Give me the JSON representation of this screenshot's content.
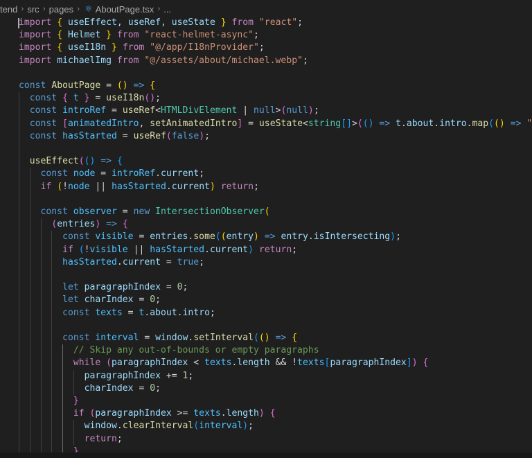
{
  "breadcrumb": {
    "items": [
      "tend",
      "src",
      "pages",
      "AboutPage.tsx",
      "..."
    ],
    "separator": "›",
    "file_icon": "react-tsx-icon"
  },
  "editor": {
    "language": "tsx",
    "theme": "dark-modern",
    "lines": [
      [
        [
          "import",
          "kw-c"
        ],
        [
          " ",
          "pun"
        ],
        [
          "{",
          "b1"
        ],
        [
          " useEffect, useRef, useState ",
          "var"
        ],
        [
          "}",
          "b1"
        ],
        [
          " from ",
          "kw-c"
        ],
        [
          "\"react\"",
          "str"
        ],
        [
          ";",
          "pun"
        ]
      ],
      [
        [
          "import",
          "kw-c"
        ],
        [
          " ",
          "pun"
        ],
        [
          "{",
          "b1"
        ],
        [
          " Helmet ",
          "var"
        ],
        [
          "}",
          "b1"
        ],
        [
          " from ",
          "kw-c"
        ],
        [
          "\"react-helmet-async\"",
          "str"
        ],
        [
          ";",
          "pun"
        ]
      ],
      [
        [
          "import",
          "kw-c"
        ],
        [
          " ",
          "pun"
        ],
        [
          "{",
          "b1"
        ],
        [
          " useI18n ",
          "var"
        ],
        [
          "}",
          "b1"
        ],
        [
          " from ",
          "kw-c"
        ],
        [
          "\"@/app/I18nProvider\"",
          "str"
        ],
        [
          ";",
          "pun"
        ]
      ],
      [
        [
          "import",
          "kw-c"
        ],
        [
          " michaelImg ",
          "var"
        ],
        [
          "from ",
          "kw-c"
        ],
        [
          "\"@/assets/about/michael.webp\"",
          "str"
        ],
        [
          ";",
          "pun"
        ]
      ],
      [],
      [
        [
          "const ",
          "kw"
        ],
        [
          "AboutPage",
          "fn"
        ],
        [
          " = ",
          "pun"
        ],
        [
          "()",
          "b1"
        ],
        [
          " => ",
          "kw"
        ],
        [
          "{",
          "b1"
        ]
      ],
      [
        [
          "  const ",
          "kw"
        ],
        [
          "{",
          "b2"
        ],
        [
          " t ",
          "cst"
        ],
        [
          "}",
          "b2"
        ],
        [
          " = ",
          "pun"
        ],
        [
          "useI18n",
          "fn"
        ],
        [
          "()",
          "b2"
        ],
        [
          ";",
          "pun"
        ]
      ],
      [
        [
          "  const ",
          "kw"
        ],
        [
          "introRef",
          "cst"
        ],
        [
          " = ",
          "pun"
        ],
        [
          "useRef",
          "fn"
        ],
        [
          "<",
          "pun"
        ],
        [
          "HTMLDivElement",
          "typ"
        ],
        [
          " | ",
          "pun"
        ],
        [
          "null",
          "kw"
        ],
        [
          ">",
          "pun"
        ],
        [
          "(",
          "b2"
        ],
        [
          "null",
          "kw"
        ],
        [
          ")",
          "b2"
        ],
        [
          ";",
          "pun"
        ]
      ],
      [
        [
          "  const ",
          "kw"
        ],
        [
          "[",
          "b2"
        ],
        [
          "animatedIntro",
          "cst"
        ],
        [
          ", ",
          "pun"
        ],
        [
          "setAnimatedIntro",
          "fn"
        ],
        [
          "]",
          "b2"
        ],
        [
          " = ",
          "pun"
        ],
        [
          "useState",
          "fn"
        ],
        [
          "<",
          "pun"
        ],
        [
          "string",
          "typ"
        ],
        [
          "[]",
          "b3"
        ],
        [
          ">",
          "pun"
        ],
        [
          "(",
          "b2"
        ],
        [
          "()",
          "b3"
        ],
        [
          " => ",
          "kw"
        ],
        [
          "t",
          "var"
        ],
        [
          ".",
          "pun"
        ],
        [
          "about",
          "var"
        ],
        [
          ".",
          "pun"
        ],
        [
          "intro",
          "var"
        ],
        [
          ".",
          "pun"
        ],
        [
          "map",
          "fn"
        ],
        [
          "(",
          "b3"
        ],
        [
          "()",
          "b1"
        ],
        [
          " => ",
          "kw"
        ],
        [
          "\"\"",
          "str"
        ],
        [
          ")",
          "b3"
        ],
        [
          ")",
          "b2"
        ],
        [
          ";",
          "pun"
        ]
      ],
      [
        [
          "  const ",
          "kw"
        ],
        [
          "hasStarted",
          "cst"
        ],
        [
          " = ",
          "pun"
        ],
        [
          "useRef",
          "fn"
        ],
        [
          "(",
          "b2"
        ],
        [
          "false",
          "kw"
        ],
        [
          ")",
          "b2"
        ],
        [
          ";",
          "pun"
        ]
      ],
      [],
      [
        [
          "  ",
          "pun"
        ],
        [
          "useEffect",
          "fn"
        ],
        [
          "(",
          "b2"
        ],
        [
          "()",
          "b3"
        ],
        [
          " => ",
          "kw"
        ],
        [
          "{",
          "b3"
        ]
      ],
      [
        [
          "    const ",
          "kw"
        ],
        [
          "node",
          "cst"
        ],
        [
          " = ",
          "pun"
        ],
        [
          "introRef",
          "cst"
        ],
        [
          ".",
          "pun"
        ],
        [
          "current",
          "var"
        ],
        [
          ";",
          "pun"
        ]
      ],
      [
        [
          "    if ",
          "kw-c"
        ],
        [
          "(",
          "b1"
        ],
        [
          "!",
          "pun"
        ],
        [
          "node",
          "cst"
        ],
        [
          " || ",
          "pun"
        ],
        [
          "hasStarted",
          "cst"
        ],
        [
          ".",
          "pun"
        ],
        [
          "current",
          "var"
        ],
        [
          ")",
          "b1"
        ],
        [
          " return",
          "kw-c"
        ],
        [
          ";",
          "pun"
        ]
      ],
      [],
      [
        [
          "    const ",
          "kw"
        ],
        [
          "observer",
          "cst"
        ],
        [
          " = ",
          "pun"
        ],
        [
          "new ",
          "kw"
        ],
        [
          "IntersectionObserver",
          "typ"
        ],
        [
          "(",
          "b1"
        ]
      ],
      [
        [
          "      ",
          "pun"
        ],
        [
          "(",
          "b2"
        ],
        [
          "entries",
          "var"
        ],
        [
          ")",
          "b2"
        ],
        [
          " => ",
          "kw"
        ],
        [
          "{",
          "b2"
        ]
      ],
      [
        [
          "        const ",
          "kw"
        ],
        [
          "visible",
          "cst"
        ],
        [
          " = ",
          "pun"
        ],
        [
          "entries",
          "var"
        ],
        [
          ".",
          "pun"
        ],
        [
          "some",
          "fn"
        ],
        [
          "(",
          "b3"
        ],
        [
          "(",
          "b1"
        ],
        [
          "entry",
          "var"
        ],
        [
          ")",
          "b1"
        ],
        [
          " => ",
          "kw"
        ],
        [
          "entry",
          "var"
        ],
        [
          ".",
          "pun"
        ],
        [
          "isIntersecting",
          "var"
        ],
        [
          ")",
          "b3"
        ],
        [
          ";",
          "pun"
        ]
      ],
      [
        [
          "        if ",
          "kw-c"
        ],
        [
          "(",
          "b3"
        ],
        [
          "!",
          "pun"
        ],
        [
          "visible",
          "cst"
        ],
        [
          " || ",
          "pun"
        ],
        [
          "hasStarted",
          "cst"
        ],
        [
          ".",
          "pun"
        ],
        [
          "current",
          "var"
        ],
        [
          ")",
          "b3"
        ],
        [
          " return",
          "kw-c"
        ],
        [
          ";",
          "pun"
        ]
      ],
      [
        [
          "        ",
          "pun"
        ],
        [
          "hasStarted",
          "cst"
        ],
        [
          ".",
          "pun"
        ],
        [
          "current",
          "var"
        ],
        [
          " = ",
          "pun"
        ],
        [
          "true",
          "kw"
        ],
        [
          ";",
          "pun"
        ]
      ],
      [],
      [
        [
          "        let ",
          "kw"
        ],
        [
          "paragraphIndex",
          "var"
        ],
        [
          " = ",
          "pun"
        ],
        [
          "0",
          "num"
        ],
        [
          ";",
          "pun"
        ]
      ],
      [
        [
          "        let ",
          "kw"
        ],
        [
          "charIndex",
          "var"
        ],
        [
          " = ",
          "pun"
        ],
        [
          "0",
          "num"
        ],
        [
          ";",
          "pun"
        ]
      ],
      [
        [
          "        const ",
          "kw"
        ],
        [
          "texts",
          "cst"
        ],
        [
          " = ",
          "pun"
        ],
        [
          "t",
          "cst"
        ],
        [
          ".",
          "pun"
        ],
        [
          "about",
          "var"
        ],
        [
          ".",
          "pun"
        ],
        [
          "intro",
          "var"
        ],
        [
          ";",
          "pun"
        ]
      ],
      [],
      [
        [
          "        const ",
          "kw"
        ],
        [
          "interval",
          "cst"
        ],
        [
          " = ",
          "pun"
        ],
        [
          "window",
          "var"
        ],
        [
          ".",
          "pun"
        ],
        [
          "setInterval",
          "fn"
        ],
        [
          "(",
          "b3"
        ],
        [
          "()",
          "b1"
        ],
        [
          " => ",
          "kw"
        ],
        [
          "{",
          "b1"
        ]
      ],
      [
        [
          "          // Skip any out-of-bounds or empty paragraphs",
          "cmt"
        ]
      ],
      [
        [
          "          while ",
          "kw-c"
        ],
        [
          "(",
          "b2"
        ],
        [
          "paragraphIndex",
          "var"
        ],
        [
          " < ",
          "pun"
        ],
        [
          "texts",
          "cst"
        ],
        [
          ".",
          "pun"
        ],
        [
          "length",
          "var"
        ],
        [
          " && ",
          "pun"
        ],
        [
          "!",
          "pun"
        ],
        [
          "texts",
          "cst"
        ],
        [
          "[",
          "b3"
        ],
        [
          "paragraphIndex",
          "var"
        ],
        [
          "]",
          "b3"
        ],
        [
          ")",
          "b2"
        ],
        [
          " ",
          "pun"
        ],
        [
          "{",
          "b2"
        ]
      ],
      [
        [
          "            ",
          "pun"
        ],
        [
          "paragraphIndex",
          "var"
        ],
        [
          " += ",
          "pun"
        ],
        [
          "1",
          "num"
        ],
        [
          ";",
          "pun"
        ]
      ],
      [
        [
          "            ",
          "pun"
        ],
        [
          "charIndex",
          "var"
        ],
        [
          " = ",
          "pun"
        ],
        [
          "0",
          "num"
        ],
        [
          ";",
          "pun"
        ]
      ],
      [
        [
          "          ",
          "pun"
        ],
        [
          "}",
          "b2"
        ]
      ],
      [
        [
          "          if ",
          "kw-c"
        ],
        [
          "(",
          "b2"
        ],
        [
          "paragraphIndex",
          "var"
        ],
        [
          " >= ",
          "pun"
        ],
        [
          "texts",
          "cst"
        ],
        [
          ".",
          "pun"
        ],
        [
          "length",
          "var"
        ],
        [
          ")",
          "b2"
        ],
        [
          " ",
          "pun"
        ],
        [
          "{",
          "b2"
        ]
      ],
      [
        [
          "            ",
          "pun"
        ],
        [
          "window",
          "var"
        ],
        [
          ".",
          "pun"
        ],
        [
          "clearInterval",
          "fn"
        ],
        [
          "(",
          "b3"
        ],
        [
          "interval",
          "cst"
        ],
        [
          ")",
          "b3"
        ],
        [
          ";",
          "pun"
        ]
      ],
      [
        [
          "            return",
          "kw-c"
        ],
        [
          ";",
          "pun"
        ]
      ],
      [
        [
          "          ",
          "pun"
        ],
        [
          "}",
          "b2"
        ]
      ]
    ]
  }
}
